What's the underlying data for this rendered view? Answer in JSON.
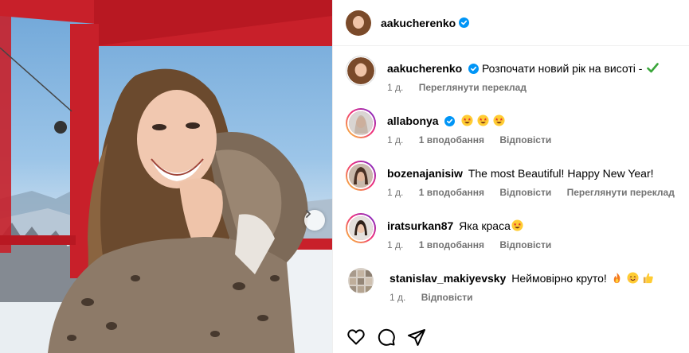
{
  "post": {
    "author": "aakucherenko",
    "author_verified": true
  },
  "caption": {
    "username": "aakucherenko",
    "text": "Розпочати новий рік на висоті -",
    "time": "1 д.",
    "translate_label": "Переглянути переклад"
  },
  "comments": [
    {
      "username": "allabonya",
      "verified": true,
      "text": "",
      "emoji": [
        "star-struck-emoji",
        "star-struck-emoji",
        "star-struck-emoji"
      ],
      "time": "1 д.",
      "likes": "1 вподобання",
      "reply": "Відповісти",
      "translate": ""
    },
    {
      "username": "bozenajanisiw",
      "verified": false,
      "text": "The most Beautiful! Happy New Year!",
      "emoji": [],
      "time": "1 д.",
      "likes": "1 вподобання",
      "reply": "Відповісти",
      "translate": "Переглянути переклад"
    },
    {
      "username": "iratsurkan87",
      "verified": false,
      "text": "Яка краса",
      "emoji": [
        "star-struck-emoji"
      ],
      "time": "1 д.",
      "likes": "1 вподобання",
      "reply": "Відповісти",
      "translate": ""
    },
    {
      "username": "stanislav_makiyevsky",
      "verified": false,
      "text": "Неймовірно круто!",
      "emoji": [
        "fire-emoji",
        "smiling-emoji",
        "thumbs-up-emoji"
      ],
      "time": "1 д.",
      "likes": "",
      "reply": "Відповісти",
      "translate": ""
    }
  ],
  "actions": [
    "heart-icon",
    "comment-icon",
    "share-icon"
  ],
  "colors": {
    "verified_blue": "#0095f6",
    "meta_gray": "#737373",
    "cabin_red": "#c8202a",
    "check_green": "#3aa63a"
  }
}
